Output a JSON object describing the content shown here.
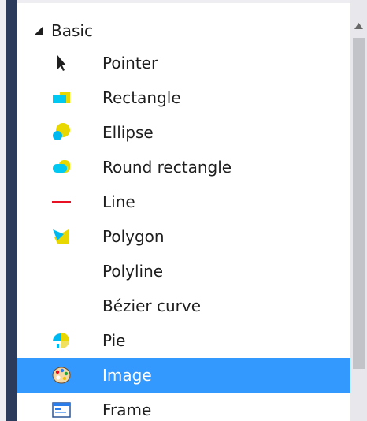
{
  "toolbox": {
    "group": {
      "label": "Basic",
      "expand_icon": "triangle-expanded-icon"
    },
    "items": [
      {
        "label": "Pointer",
        "icon": "pointer-icon"
      },
      {
        "label": "Rectangle",
        "icon": "rectangle-icon"
      },
      {
        "label": "Ellipse",
        "icon": "ellipse-icon"
      },
      {
        "label": "Round rectangle",
        "icon": "round-rectangle-icon"
      },
      {
        "label": "Line",
        "icon": "line-icon"
      },
      {
        "label": "Polygon",
        "icon": "polygon-icon"
      },
      {
        "label": "Polyline",
        "icon": ""
      },
      {
        "label": "Bézier curve",
        "icon": ""
      },
      {
        "label": "Pie",
        "icon": "pie-icon"
      },
      {
        "label": "Image",
        "icon": "palette-icon",
        "selected": true
      },
      {
        "label": "Frame",
        "icon": "frame-icon"
      }
    ]
  },
  "colors": {
    "selection": "#3399ff",
    "dark_bar": "#2c3b5c",
    "scroll_thumb": "#c2c3c9"
  }
}
